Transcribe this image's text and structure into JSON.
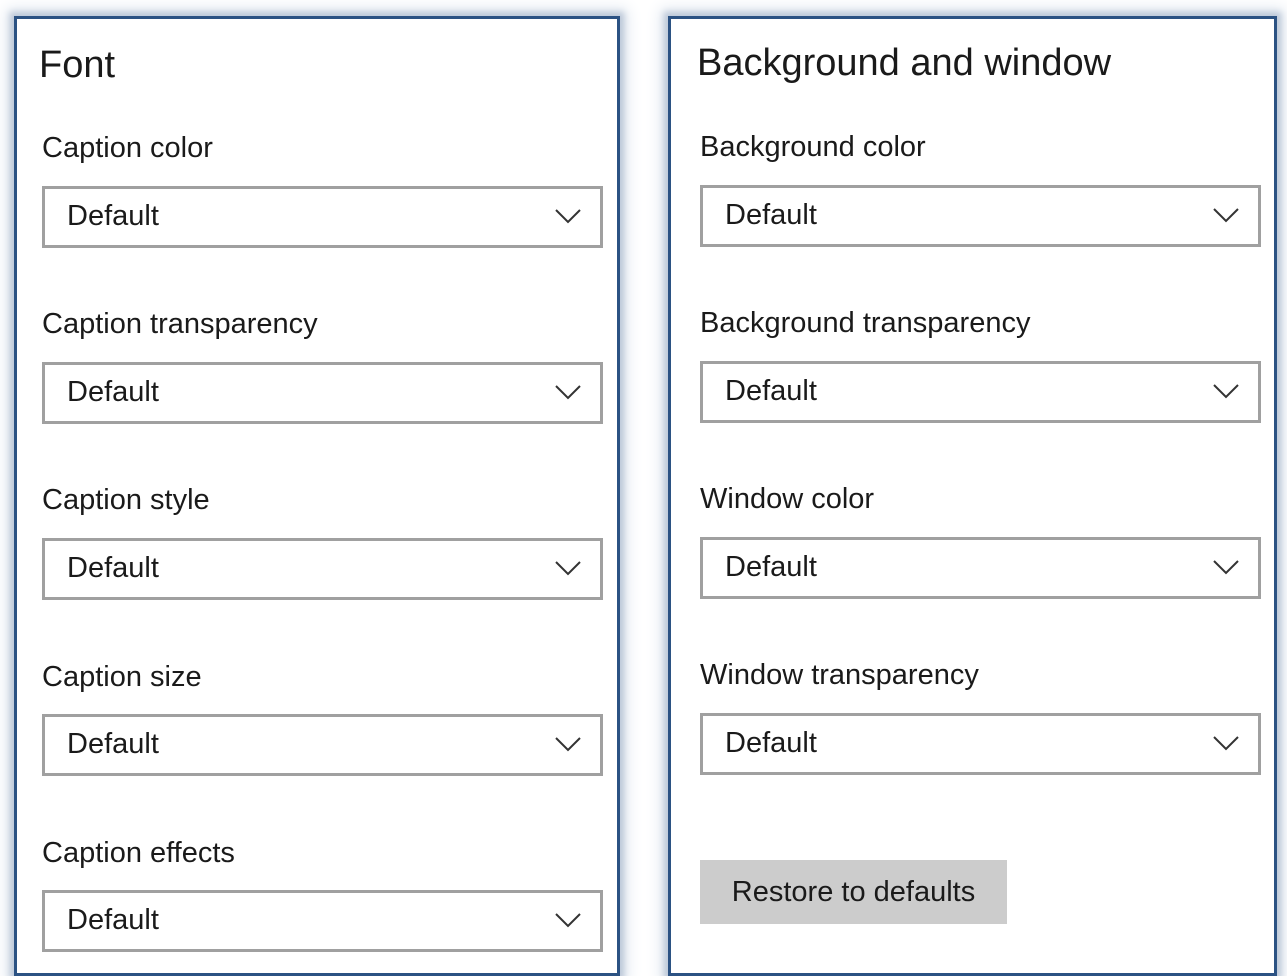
{
  "font_panel": {
    "title": "Font",
    "fields": [
      {
        "label": "Caption color",
        "value": "Default"
      },
      {
        "label": "Caption transparency",
        "value": "Default"
      },
      {
        "label": "Caption style",
        "value": "Default"
      },
      {
        "label": "Caption size",
        "value": "Default"
      },
      {
        "label": "Caption effects",
        "value": "Default"
      }
    ]
  },
  "background_panel": {
    "title": "Background and window",
    "fields": [
      {
        "label": "Background color",
        "value": "Default"
      },
      {
        "label": "Background transparency",
        "value": "Default"
      },
      {
        "label": "Window color",
        "value": "Default"
      },
      {
        "label": "Window transparency",
        "value": "Default"
      }
    ],
    "restore_label": "Restore to defaults"
  },
  "icons": {
    "dropdown_chevron": "chevron-down-icon"
  },
  "colors": {
    "panel_border": "#2b5283",
    "dropdown_border": "#a0a0a0",
    "button_background": "#cccccc",
    "text": "#1a1a1a"
  }
}
